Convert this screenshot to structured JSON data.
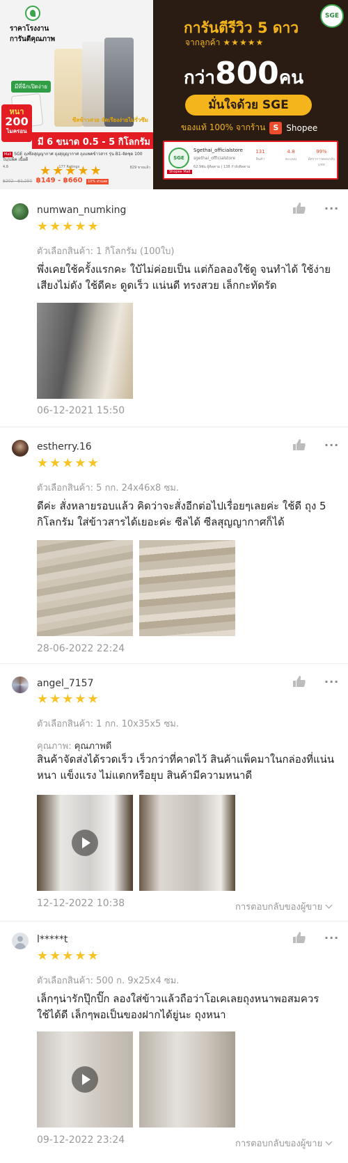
{
  "banner_left": {
    "headline_line1": "ราคาโรงงาน",
    "headline_line2": "การันตีคุณภาพ",
    "tear_tag": "มีที่ฉีกเปิดง่าย",
    "thick_l1": "หนา",
    "thick_l2": "200",
    "thick_l3": "ไมครอน",
    "yellow_note": "ซีลข้าวสวย จัดเรียงง่ายไม่รั่วซึม",
    "sizes": "มี 6 ขนาด 0.5 - 5 กิโลกรัม",
    "mall_badge": "Mall",
    "product_title": "SGE ถุงซีลสุญญากาศ ถุงสุญญากาศ ถุงแพคข้าวสาร รุ่น B1-จัดชุด 100 ใบ/แพ็ค เนื้อดี",
    "rating": "4.8",
    "stars": "★★★★★",
    "ratings_count": "177 Ratings",
    "sold": "829 ขายแล้ว",
    "price_old": "฿202 - ฿1,250",
    "price_now": "฿149 - ฿660",
    "discount": "10% ส่วนลด"
  },
  "banner_right": {
    "logo_text": "SGE",
    "line1": "การันตีรีวิว 5 ดาว",
    "line2": "จากลูกค้า",
    "line2_stars": "★★★★★",
    "big_pre": "กว่า",
    "big_num": "800",
    "big_post": "คน",
    "pill": "มั่นใจด้วย SGE",
    "authentic": "ของแท้ 100% จากร้าน",
    "shopee": "Shopee",
    "shopee_glyph": "S",
    "card": {
      "logo_text": "SGE",
      "mall_tag": "Shopee Mall",
      "name": "Sgethai_officialstore",
      "handle": "sgethai_officialstore",
      "stats_line": "62.9พัน ผู้ติดตาม | 138 กำลังติดตาม",
      "products": "131",
      "products_label": "สินค้า",
      "rating": "4.8",
      "rating_label": "คะแนน",
      "chat": "99%",
      "chat_label": "อัตราการตอบกลับแชท"
    }
  },
  "reviews": [
    {
      "username": "numwan_numking",
      "stars": "★★★★★",
      "variation": "ตัวเลือกสินค้า: 1 กิโลกรัม (100ใบ)",
      "body": "พึ่งเคยใช้ครั้งแรกคะ ใบ้ไม่ค่อยเป็น แต่ก้อลองใช้ดู จนทำได้ ใช้ง่าย เสียงไม่ดัง ใช้ดีคะ ดูดเร็ว แน่นดี ทรงสวย เล็กกะทัดรัด",
      "date": "06-12-2021 15:50"
    },
    {
      "username": "estherry.16",
      "stars": "★★★★★",
      "variation": "ตัวเลือกสินค้า: 5 กก. 24x46x8 ซม.",
      "body": "ดีค่ะ สั่งหลายรอบแล้ว คิดว่าจะสั่งอีกต่อไปเรื่อยๆเลยค่ะ ใช้ดี ถุง 5 กิโลกรัม ใส่ข้าวสารได้เยอะค่ะ ซีลได้ ซีลสุญญากาศก็ได้",
      "date": "28-06-2022 22:24"
    },
    {
      "username": "angel_7157",
      "stars": "★★★★★",
      "variation": "ตัวเลือกสินค้า: 1 กก. 10x35x5 ซม.",
      "quality_label": "คุณภาพ:",
      "quality_value": "คุณภาพดี",
      "body": "สินค้าจัดส่งได้รวดเร็ว เร็วกว่าที่คาดไว้ สินค้าแพ็คมาในกล่องที่แน่นหนา แข็งแรง ไม่แตกหรือยุบ สินค้ามีความหนาดี",
      "date": "12-12-2022 10:38",
      "seller_reply": "การตอบกลับของผู้ขาย"
    },
    {
      "username": "l*****t",
      "stars": "★★★★★",
      "variation": "ตัวเลือกสินค้า: 500 ก. 9x25x4 ซม.",
      "body": "เล็กๆน่ารักปุ๊กปิ๊ก ลองใส่ข้าวแล้วถือว่าโอเคเลยถุงหนาพอสมควรใช้ได้ดี เล็กๆพอเป็นของฝากได้ยู่นะ ถุงหนา",
      "date": "09-12-2022 23:24",
      "seller_reply": "การตอบกลับของผู้ขาย"
    }
  ],
  "more_glyph": "···"
}
